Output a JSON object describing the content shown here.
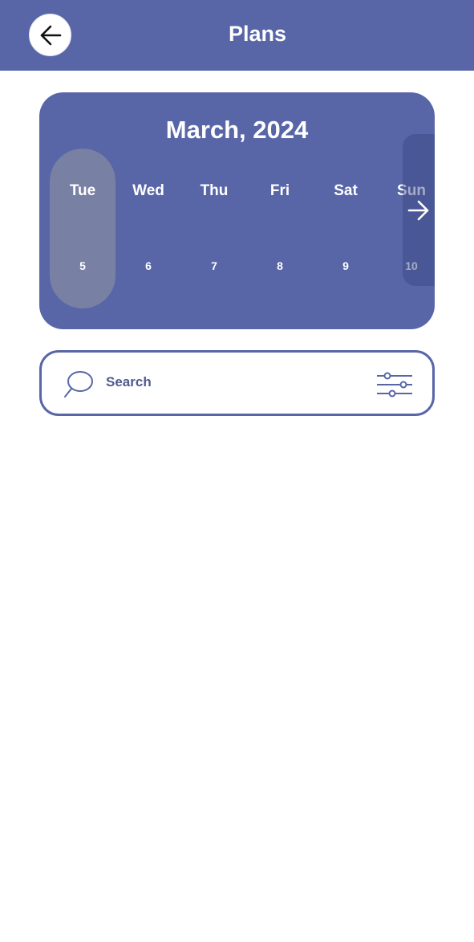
{
  "header": {
    "title": "Plans",
    "back_icon": "arrow-left-icon"
  },
  "calendar": {
    "month_title": "March, 2024",
    "days": [
      {
        "name": "Tue",
        "date": "5",
        "selected": true
      },
      {
        "name": "Wed",
        "date": "6",
        "selected": false
      },
      {
        "name": "Thu",
        "date": "7",
        "selected": false
      },
      {
        "name": "Fri",
        "date": "8",
        "selected": false
      },
      {
        "name": "Sat",
        "date": "9",
        "selected": false
      },
      {
        "name": "Sun",
        "date": "10",
        "selected": false
      }
    ],
    "next_icon": "arrow-right-icon"
  },
  "search": {
    "placeholder": "Search",
    "icon": "search-icon",
    "filter_icon": "filter-sliders-icon"
  },
  "colors": {
    "primary": "#5866a8",
    "selected_day": "#7880a3",
    "background": "#ffffff"
  }
}
